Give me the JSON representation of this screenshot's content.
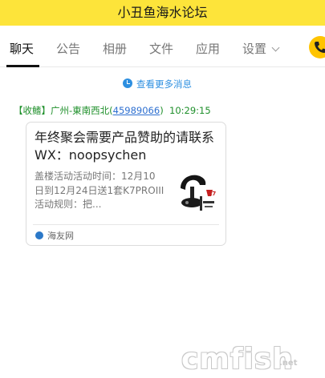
{
  "window": {
    "title": "小丑鱼海水论坛"
  },
  "tabs": [
    {
      "label": "聊天"
    },
    {
      "label": "公告"
    },
    {
      "label": "相册"
    },
    {
      "label": "文件"
    },
    {
      "label": "应用"
    },
    {
      "label": "设置"
    }
  ],
  "chat": {
    "load_more": "查看更多消息",
    "message": {
      "role_tag": "【收鳍】",
      "sender_name": "广州-東南西北(",
      "sender_qq": "45989066",
      "sender_close": ")",
      "time": "10:29:15"
    },
    "card": {
      "title": "年终聚会需要产品赞助的请联系WX：noopsychen",
      "description": "盖楼活动活动时间：12月10日到12月24日送1套K7PROIII活动规则：把...",
      "source": "海友网"
    }
  },
  "watermark": {
    "text": "cmfish",
    "suffix": ".net"
  },
  "colors": {
    "titlebar_bg": "#fde43a",
    "link_blue": "#2d8fe0",
    "sender_green": "#1e8f2a",
    "phone_badge": "#ffc400"
  }
}
